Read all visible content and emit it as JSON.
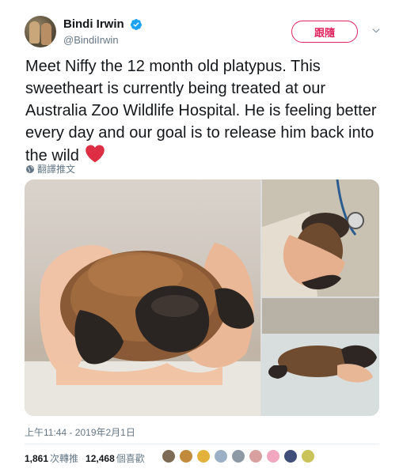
{
  "author": {
    "display_name": "Bindi Irwin",
    "handle": "@BindiIrwin",
    "verified": true
  },
  "follow_button": {
    "label": "跟隨"
  },
  "tweet": {
    "text": "Meet Niffy the 12 month old platypus. This sweetheart is currently being treated at our Australia Zoo Wildlife Hospital. He is feeling better every day and our goal is to release him back into the wild",
    "emoji": "red-heart"
  },
  "translate_link": {
    "label": "翻譯推文",
    "icon": "globe-icon"
  },
  "media": [
    {
      "description_icon": "photo-platypus-held-in-hands"
    },
    {
      "description_icon": "photo-platypus-with-stethoscope"
    },
    {
      "description_icon": "photo-platypus-on-table"
    }
  ],
  "timestamp": "上午11:44 - 2019年2月1日",
  "stats": {
    "retweets_count": "1,861",
    "retweets_label": "次轉推",
    "likes_count": "12,468",
    "likes_label": "個喜歡"
  },
  "colors": {
    "brand_blue": "#1da1f2",
    "follow_red": "#e0245e",
    "heart_red": "#e0245e",
    "muted_gray": "#657786"
  },
  "liker_avatars": [
    "#7d6b55",
    "#c28a3c",
    "#e3b23c",
    "#9bb0c4",
    "#8d9aa6",
    "#d9a0a0",
    "#f1a7c0",
    "#3f4f7a",
    "#c9c35a"
  ]
}
